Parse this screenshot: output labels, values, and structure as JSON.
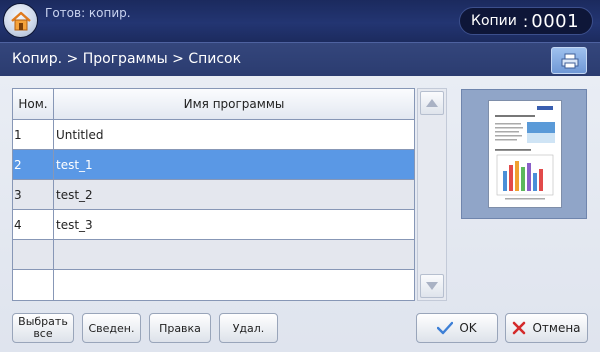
{
  "topbar": {
    "status": "Готов: копир.",
    "copies_label": "Копии",
    "copies_colon": ":",
    "copies_value": "0001"
  },
  "breadcrumb": {
    "text": "Копир. > Программы > Список"
  },
  "table": {
    "header_num": "Ном.",
    "header_name": "Имя программы",
    "rows": [
      {
        "num": "1",
        "name": "Untitled"
      },
      {
        "num": "2",
        "name": "test_1"
      },
      {
        "num": "3",
        "name": "test_2"
      },
      {
        "num": "4",
        "name": "test_3"
      },
      {
        "num": "",
        "name": ""
      },
      {
        "num": "",
        "name": ""
      }
    ]
  },
  "buttons": {
    "select_all_line1": "Выбрать",
    "select_all_line2": "все",
    "info": "Сведен.",
    "edit": "Правка",
    "delete": "Удал.",
    "ok": "OK",
    "cancel": "Отмена"
  },
  "icons": {
    "home": "home-icon",
    "breadcrumb_button": "printer-icon",
    "scroll_up": "arrow-up-icon",
    "scroll_down": "arrow-down-icon",
    "ok": "checkmark-icon",
    "cancel": "x-icon"
  },
  "colors": {
    "topbar": "#233572",
    "selected_row": "#5a98e5",
    "ok_check": "#3d7fd6",
    "cancel_x": "#d42a2a"
  }
}
